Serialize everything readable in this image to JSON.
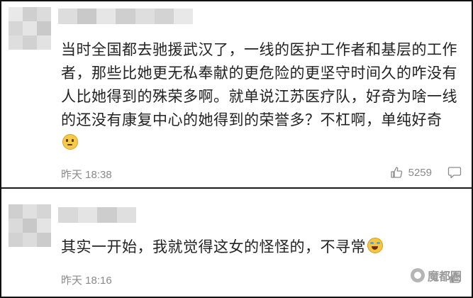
{
  "comments": [
    {
      "text": "当时全国都去驰援武汉了，一线的医护工作者和基层的工作者，那些比她更无私奉献的更危险的更坚守时间久的咋没有人比她得到的殊荣多啊。就单说江苏医疗队，好奇为啥一线的还没有康复中心的她得到的荣誉多？不杠啊，单纯好奇",
      "emoji": "thinking-face-emoji",
      "time": "昨天 18:38",
      "likes": "5259",
      "avatar_colors": [
        "#e9e9e9",
        "#cfcfcf",
        "#dcdcdc",
        "#d6d6d6",
        "#e5e5e5",
        "#c9c9c9",
        "#dedede",
        "#d1d1d1",
        "#e2e2e2"
      ],
      "username_colors": [
        "#dddddd",
        "#c9c9c9",
        "#e6e6e6",
        "#cfcfcf",
        "#dedede",
        "#d3d3d3",
        "#e8e8e8"
      ]
    },
    {
      "text": "其实一开始，我就觉得这女的怪怪的，不寻常",
      "emoji": "crying-laughing-emoji",
      "time": "昨天 18:16",
      "likes": "",
      "avatar_colors": [
        "#cfcfcf",
        "#e0e0e0",
        "#d5d5d5",
        "#dadada",
        "#c8c8c8",
        "#e4e4e4",
        "#d2d2d2",
        "#dcdcdc",
        "#cbcbcb"
      ],
      "username_colors": [
        "#d9d9d9",
        "#e4e4e4",
        "#cdcdcd",
        "#dfdfdf"
      ]
    }
  ],
  "watermark": {
    "text": "魔都圈",
    "icon": "wechat-icon"
  }
}
